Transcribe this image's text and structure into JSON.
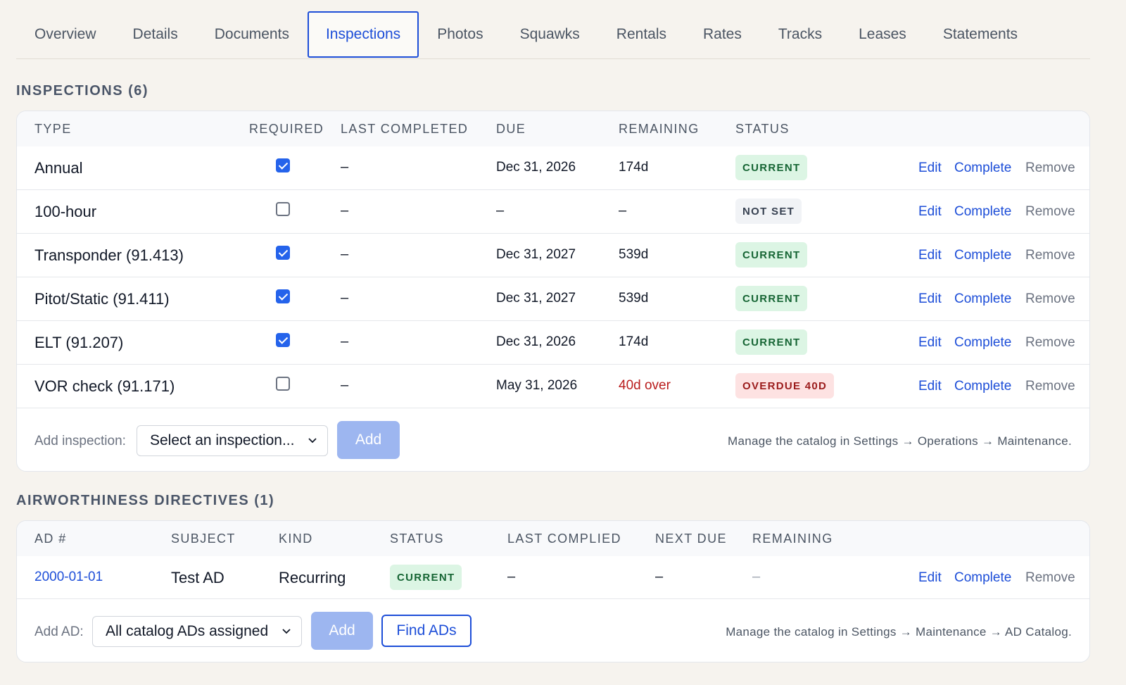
{
  "tabs": [
    "Overview",
    "Details",
    "Documents",
    "Inspections",
    "Photos",
    "Squawks",
    "Rentals",
    "Rates",
    "Tracks",
    "Leases",
    "Statements"
  ],
  "active_tab": "Inspections",
  "inspections": {
    "title": "INSPECTIONS (6)",
    "columns": [
      "TYPE",
      "REQUIRED",
      "LAST COMPLETED",
      "DUE",
      "REMAINING",
      "STATUS"
    ],
    "rows": [
      {
        "type": "Annual",
        "required": true,
        "last": "–",
        "due": "Dec 31, 2026",
        "remaining": "174d",
        "status": "CURRENT",
        "status_kind": "current"
      },
      {
        "type": "100-hour",
        "required": false,
        "last": "–",
        "due": "–",
        "remaining": "–",
        "status": "NOT SET",
        "status_kind": "notset"
      },
      {
        "type": "Transponder (91.413)",
        "required": true,
        "last": "–",
        "due": "Dec 31, 2027",
        "remaining": "539d",
        "status": "CURRENT",
        "status_kind": "current"
      },
      {
        "type": "Pitot/Static (91.411)",
        "required": true,
        "last": "–",
        "due": "Dec 31, 2027",
        "remaining": "539d",
        "status": "CURRENT",
        "status_kind": "current"
      },
      {
        "type": "ELT (91.207)",
        "required": true,
        "last": "–",
        "due": "Dec 31, 2026",
        "remaining": "174d",
        "status": "CURRENT",
        "status_kind": "current"
      },
      {
        "type": "VOR check (91.171)",
        "required": false,
        "last": "–",
        "due": "May 31, 2026",
        "remaining": "40d over",
        "status": "OVERDUE 40D",
        "status_kind": "overdue"
      }
    ],
    "actions": {
      "edit": "Edit",
      "complete": "Complete",
      "remove": "Remove"
    },
    "add_label": "Add inspection:",
    "select_value": "Select an inspection...",
    "add_button": "Add",
    "note": "Manage the catalog in Settings → Operations → Maintenance."
  },
  "ads": {
    "title": "AIRWORTHINESS DIRECTIVES (1)",
    "columns": [
      "AD #",
      "SUBJECT",
      "KIND",
      "STATUS",
      "LAST COMPLIED",
      "NEXT DUE",
      "REMAINING"
    ],
    "rows": [
      {
        "ad": "2000-01-01",
        "subject": "Test AD",
        "kind": "Recurring",
        "status": "CURRENT",
        "last": "–",
        "next": "–",
        "remaining": "–"
      }
    ],
    "actions": {
      "edit": "Edit",
      "complete": "Complete",
      "remove": "Remove"
    },
    "add_label": "Add AD:",
    "select_value": "All catalog ADs assigned",
    "add_button": "Add",
    "find_button": "Find ADs",
    "note": "Manage the catalog in Settings → Maintenance → AD Catalog."
  },
  "colors": {
    "accent": "#1d4ed8",
    "current_bg": "#dcf5e4",
    "overdue_bg": "#fde2e2",
    "background": "#f6f3ee"
  }
}
